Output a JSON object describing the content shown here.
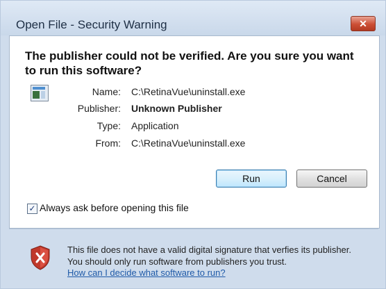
{
  "window": {
    "title": "Open File - Security Warning",
    "close_label": "✕"
  },
  "headline": "The publisher could not be verified.  Are you sure you want to run this software?",
  "fields": {
    "name": {
      "label": "Name:",
      "value": "C:\\RetinaVue\\uninstall.exe"
    },
    "publisher": {
      "label": "Publisher:",
      "value": "Unknown Publisher"
    },
    "type": {
      "label": "Type:",
      "value": "Application"
    },
    "from": {
      "label": "From:",
      "value": "C:\\RetinaVue\\uninstall.exe"
    }
  },
  "buttons": {
    "run": "Run",
    "cancel": "Cancel"
  },
  "checkbox": {
    "label": "Always ask before opening this file",
    "checked": true,
    "mark": "✓"
  },
  "warning": {
    "text": "This file does not have a valid digital signature that verfies its publisher.  You should only run software from publishers you trust.",
    "link": "How can I decide what software to run?"
  },
  "icons": {
    "app": "application-icon",
    "shield": "security-shield-icon",
    "close": "close-icon"
  },
  "colors": {
    "titlebar": "#c9d8ea",
    "close_button": "#cc4f35",
    "link": "#1f5aa8",
    "shield": "#c0392b"
  }
}
